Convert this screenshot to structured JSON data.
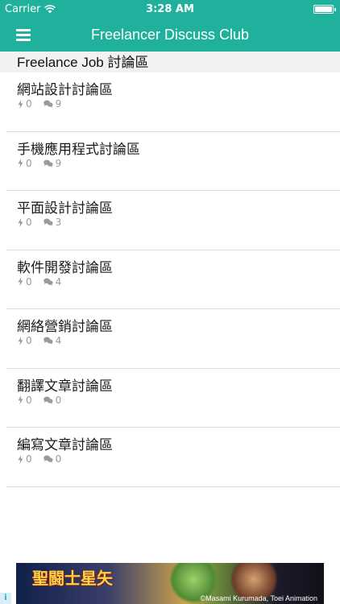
{
  "status_bar": {
    "carrier": "Carrier",
    "time": "3:28 AM",
    "wifi_icon": "wifi-icon",
    "battery_icon": "battery-icon"
  },
  "nav_bar": {
    "title": "Freelancer Discuss Club",
    "menu_icon": "hamburger-menu-icon",
    "color": "#1fb19c"
  },
  "section": {
    "header": "Freelance Job 討論區"
  },
  "forums": [
    {
      "name": "網站設計討論區",
      "likes": "0",
      "comments": "9"
    },
    {
      "name": "手機應用程式討論區",
      "likes": "0",
      "comments": "9"
    },
    {
      "name": "平面設計討論區",
      "likes": "0",
      "comments": "3"
    },
    {
      "name": "軟件開發討論區",
      "likes": "0",
      "comments": "4"
    },
    {
      "name": "網絡營銷討論區",
      "likes": "0",
      "comments": "4"
    },
    {
      "name": "翻譯文章討論區",
      "likes": "0",
      "comments": "0"
    },
    {
      "name": "編寫文章討論區",
      "likes": "0",
      "comments": "0"
    }
  ],
  "icons": {
    "likes": "bolt-icon",
    "comments": "comments-icon"
  },
  "ad": {
    "info_icon": "i",
    "logo_text": "聖闘士星矢",
    "credit": "©Masami Kurumada, Toei Animation"
  }
}
